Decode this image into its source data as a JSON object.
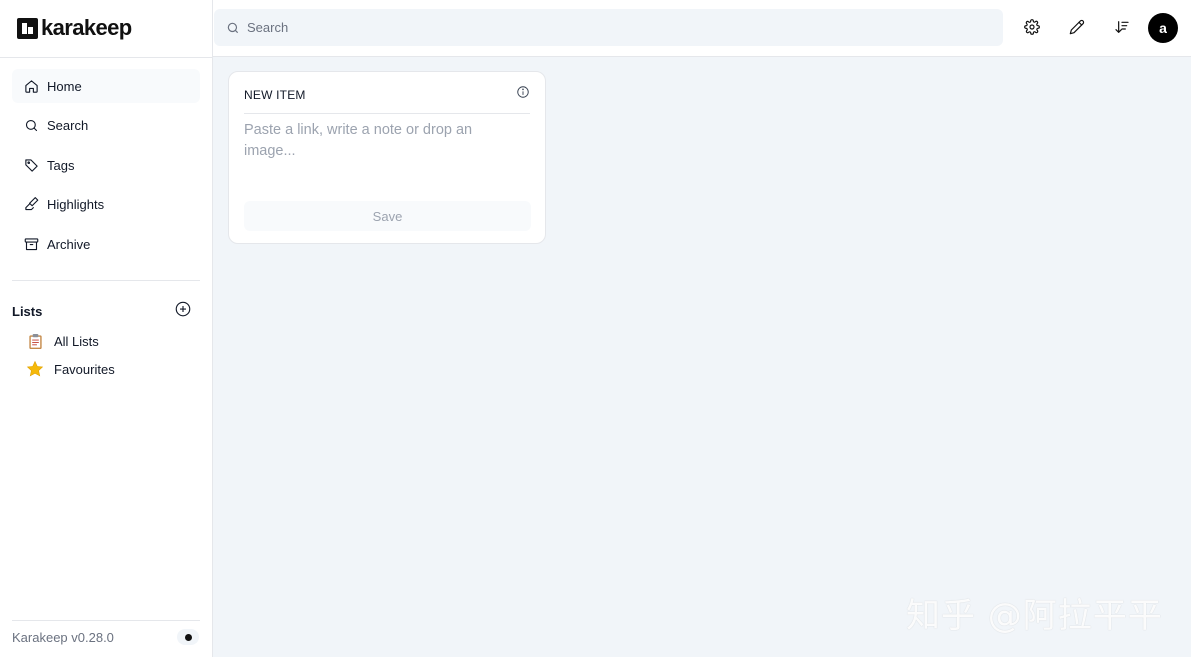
{
  "app": {
    "name": "karakeep",
    "version": "Karakeep v0.28.0"
  },
  "header": {
    "search_placeholder": "Search",
    "avatar_initial": "a",
    "icons": [
      "gear-icon",
      "pencil-icon",
      "sort-icon"
    ]
  },
  "sidebar": {
    "items": [
      {
        "label": "Home",
        "icon": "home-icon"
      },
      {
        "label": "Search",
        "icon": "search-icon"
      },
      {
        "label": "Tags",
        "icon": "tag-icon"
      },
      {
        "label": "Highlights",
        "icon": "highlighter-icon"
      },
      {
        "label": "Archive",
        "icon": "archive-icon"
      }
    ],
    "lists_title": "Lists",
    "lists": [
      {
        "label": "All Lists",
        "emoji": "📋"
      },
      {
        "label": "Favourites",
        "emoji": "⭐"
      }
    ]
  },
  "new_item": {
    "title": "NEW ITEM",
    "placeholder": "Paste a link, write a note or drop an image...",
    "save_label": "Save"
  },
  "watermark": "知乎 @阿拉平平",
  "colors": {
    "accent": "#000000",
    "background": "#f1f5f9"
  }
}
